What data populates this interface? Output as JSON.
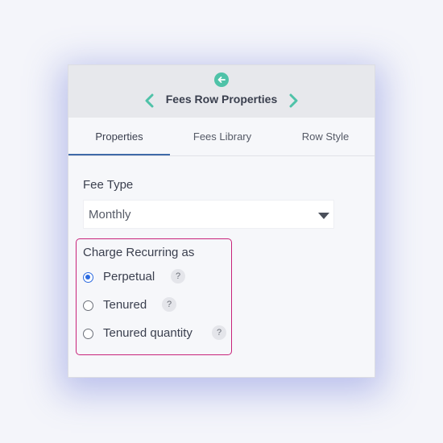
{
  "header": {
    "title": "Fees Row Properties",
    "back_icon": "arrow-left-circle-icon",
    "prev_icon": "chevron-left-icon",
    "next_icon": "chevron-right-icon",
    "accent_color": "#4fc2a8"
  },
  "tabs": [
    {
      "label": "Properties",
      "active": true
    },
    {
      "label": "Fees Library",
      "active": false
    },
    {
      "label": "Row Style",
      "active": false
    }
  ],
  "fee_type": {
    "label": "Fee Type",
    "value": "Monthly"
  },
  "charge_recurring": {
    "label": "Charge Recurring as",
    "highlight_color": "#c8237a",
    "options": [
      {
        "label": "Perpetual",
        "selected": true,
        "help": "?"
      },
      {
        "label": "Tenured",
        "selected": false,
        "help": "?"
      },
      {
        "label": "Tenured quantity",
        "selected": false,
        "help": "?"
      }
    ]
  }
}
